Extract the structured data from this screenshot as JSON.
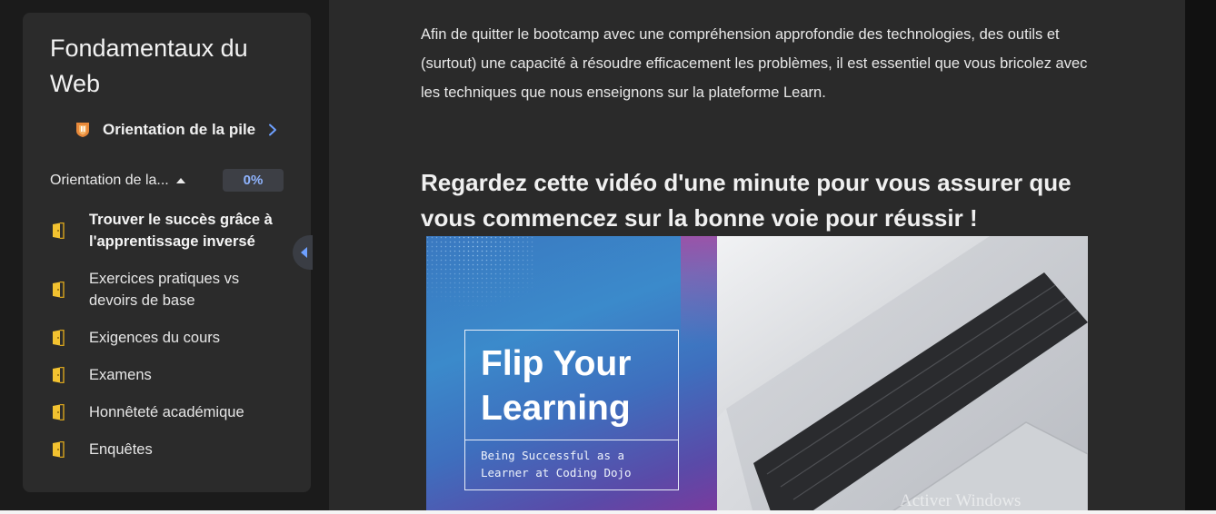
{
  "sidebar": {
    "course_title": "Fondamentaux du Web",
    "module": {
      "label": "Orientation de la pile",
      "icon": "shield-icon",
      "accent_color": "#e8893a"
    },
    "section": {
      "label": "Orientation de la...",
      "progress": "0%",
      "progress_fraction": 0
    },
    "lessons": [
      {
        "label": "Trouver le succès grâce à l'apprentissage inversé",
        "active": true
      },
      {
        "label": "Exercices pratiques vs devoirs de base",
        "active": false
      },
      {
        "label": "Exigences du cours",
        "active": false
      },
      {
        "label": "Examens",
        "active": false
      },
      {
        "label": "Honnêteté académique",
        "active": false
      },
      {
        "label": "Enquêtes",
        "active": false
      }
    ],
    "lesson_icon": "door-icon",
    "lesson_icon_color": "#f2c230"
  },
  "content": {
    "paragraph": "Afin de quitter le bootcamp avec une compréhension approfondie des technologies, des outils et (surtout) une capacité à résoudre efficacement les problèmes, il est essentiel que vous bricolez avec les techniques que nous enseignons sur la plateforme Learn.",
    "heading": "Regardez cette vidéo d'une minute pour vous assurer que vous commencez sur la bonne voie pour réussir !",
    "video": {
      "title": "Flip Your Learning",
      "subtitle": "Being Successful as a Learner at Coding Dojo"
    }
  },
  "watermark": "Activer Windows",
  "colors": {
    "background": "#1b1b1b",
    "sidebar_bg": "#2b2b2b",
    "main_bg": "#2a2a2a",
    "progress_text": "#8fb4ff",
    "chevron": "#6ea0ff"
  }
}
